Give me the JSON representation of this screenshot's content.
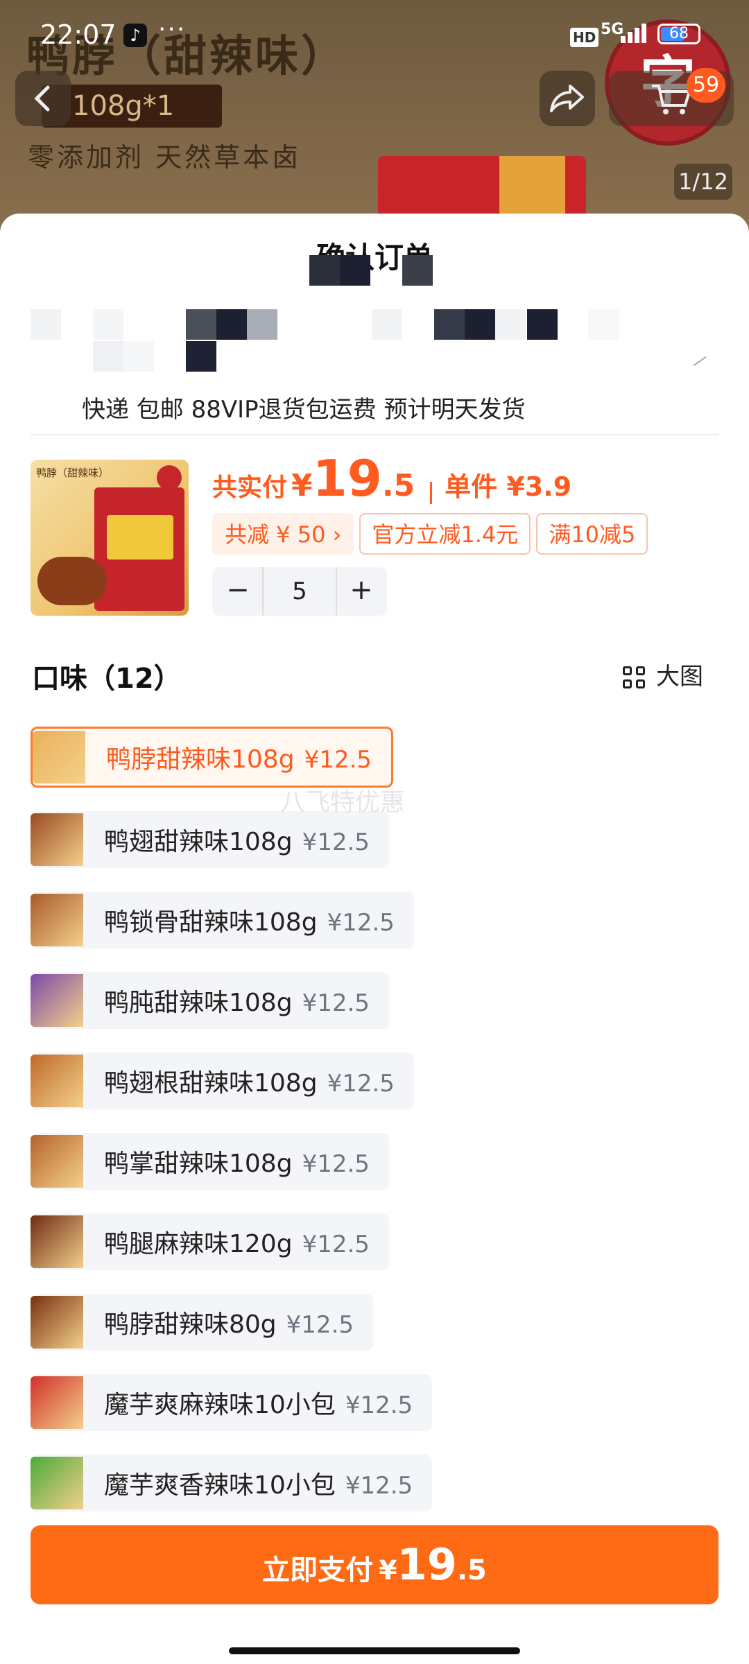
{
  "status_bar": {
    "time": "22:07",
    "dots": "···",
    "hd": "HD",
    "network": "5G",
    "battery": "68"
  },
  "background": {
    "product_title": "鸭脖（甜辣味）",
    "spec": "108g*1",
    "slogan": "零添加剂 天然草本卤",
    "seal_text": "字",
    "cart_badge": "59",
    "image_pager": "1/12",
    "icons": {
      "back": "back-chevron-icon",
      "share": "share-icon",
      "cart": "cart-icon"
    }
  },
  "sheet": {
    "title": "确认订单",
    "shipping_line": "快递 包邮 88VIP退货包运费 预计明天发货",
    "product": {
      "thumb_title": "鸭脖（甜辣味）",
      "pay_label": "共实付",
      "currency": "¥",
      "pay_amount_int": "19",
      "pay_amount_dec": ".5",
      "unit_label": "单件 ¥3.9",
      "chips": [
        "共减 ¥ 50 ›",
        "官方立减1.4元",
        "满10减5"
      ],
      "quantity": "5",
      "minus": "−",
      "plus": "+"
    },
    "flavor_header": "口味（12）",
    "big_view_label": "大图",
    "watermark": "八飞特优惠",
    "options": [
      {
        "name": "鸭脖甜辣味108g",
        "price": "¥12.5",
        "selected": true,
        "color": "#e9b15a"
      },
      {
        "name": "鸭翅甜辣味108g",
        "price": "¥12.5",
        "selected": false,
        "color": "#9a4a22"
      },
      {
        "name": "鸭锁骨甜辣味108g",
        "price": "¥12.5",
        "selected": false,
        "color": "#a85a2a"
      },
      {
        "name": "鸭肫甜辣味108g",
        "price": "¥12.5",
        "selected": false,
        "color": "#7d4aa8"
      },
      {
        "name": "鸭翅根甜辣味108g",
        "price": "¥12.5",
        "selected": false,
        "color": "#c06a2a"
      },
      {
        "name": "鸭掌甜辣味108g",
        "price": "¥12.5",
        "selected": false,
        "color": "#b6622c"
      },
      {
        "name": "鸭腿麻辣味120g",
        "price": "¥12.5",
        "selected": false,
        "color": "#6e2a14"
      },
      {
        "name": "鸭脖甜辣味80g",
        "price": "¥12.5",
        "selected": false,
        "color": "#7a3010"
      },
      {
        "name": "魔芋爽麻辣味10小包",
        "price": "¥12.5",
        "selected": false,
        "color": "#d2302a"
      },
      {
        "name": "魔芋爽香辣味10小包",
        "price": "¥12.5",
        "selected": false,
        "color": "#4caa3a"
      }
    ],
    "pay_button": {
      "label": "立即支付",
      "currency": "¥",
      "amount_int": "19",
      "amount_dec": ".5"
    }
  },
  "colors": {
    "accent": "#ff5a1f",
    "button": "#ff6a15",
    "chip_bg": "#fff1e8",
    "option_bg": "#f3f5f8"
  }
}
